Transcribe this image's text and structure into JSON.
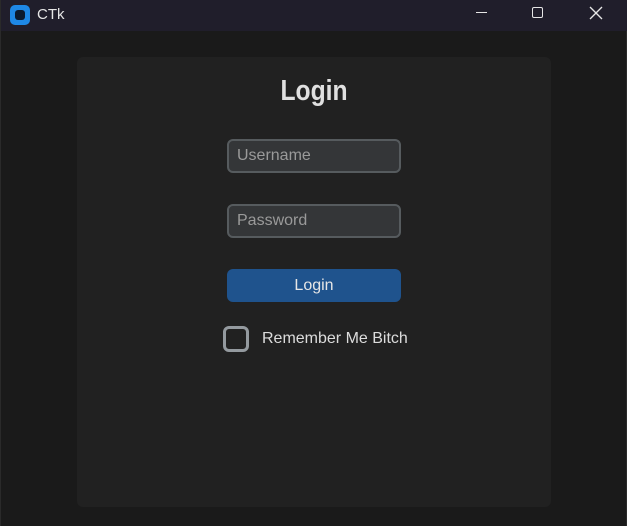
{
  "window": {
    "title": "CTk",
    "app_icon": "app-icon",
    "controls": [
      "minimize-icon",
      "maximize-icon",
      "close-icon"
    ]
  },
  "form": {
    "title": "Login",
    "username": {
      "placeholder": "Username",
      "value": ""
    },
    "password": {
      "placeholder": "Password",
      "value": ""
    },
    "login_button": "Login",
    "remember": {
      "label": "Remember Me Bitch",
      "checked": false
    }
  },
  "colors": {
    "titlebar_bg": "#201e2b",
    "window_bg": "#1a1a1a",
    "frame_bg": "#212121",
    "entry_bg": "#343638",
    "entry_border": "#565b5e",
    "button_bg": "#1f538d",
    "checkbox_border": "#949a9f",
    "app_icon": "#1e88e5"
  }
}
